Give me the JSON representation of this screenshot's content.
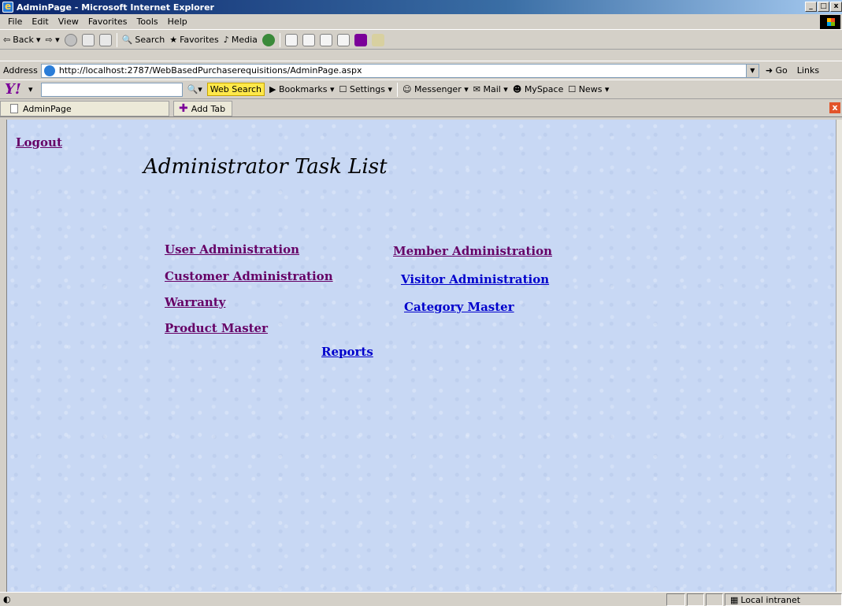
{
  "window": {
    "title": "AdminPage - Microsoft Internet Explorer",
    "buttons": [
      "_",
      "□",
      "x"
    ]
  },
  "menu": [
    "File",
    "Edit",
    "View",
    "Favorites",
    "Tools",
    "Help"
  ],
  "toolbar": {
    "back": "Back",
    "search": "Search",
    "favorites": "Favorites",
    "media": "Media"
  },
  "address": {
    "label": "Address",
    "url": "http://localhost:2787/WebBasedPurchaserequisitions/AdminPage.aspx",
    "go": "Go",
    "links": "Links"
  },
  "yahoo": {
    "logo": "Y!",
    "web_search": "Web Search",
    "bookmarks": "Bookmarks",
    "settings": "Settings",
    "messenger": "Messenger",
    "mail": "Mail",
    "myspace": "MySpace",
    "news": "News"
  },
  "tabs": {
    "active": "AdminPage",
    "add": "Add Tab"
  },
  "page": {
    "logout": "Logout",
    "title": "Administrator Task List",
    "links": {
      "user_admin": "User Administration",
      "customer_admin": "Customer Administration",
      "warranty": "Warranty",
      "product_master": "Product Master",
      "member_admin": "Member Administration",
      "visitor_admin": "Visitor Administration",
      "category_master": "Category Master",
      "reports": "Reports"
    }
  },
  "status": {
    "zone": "Local intranet"
  }
}
